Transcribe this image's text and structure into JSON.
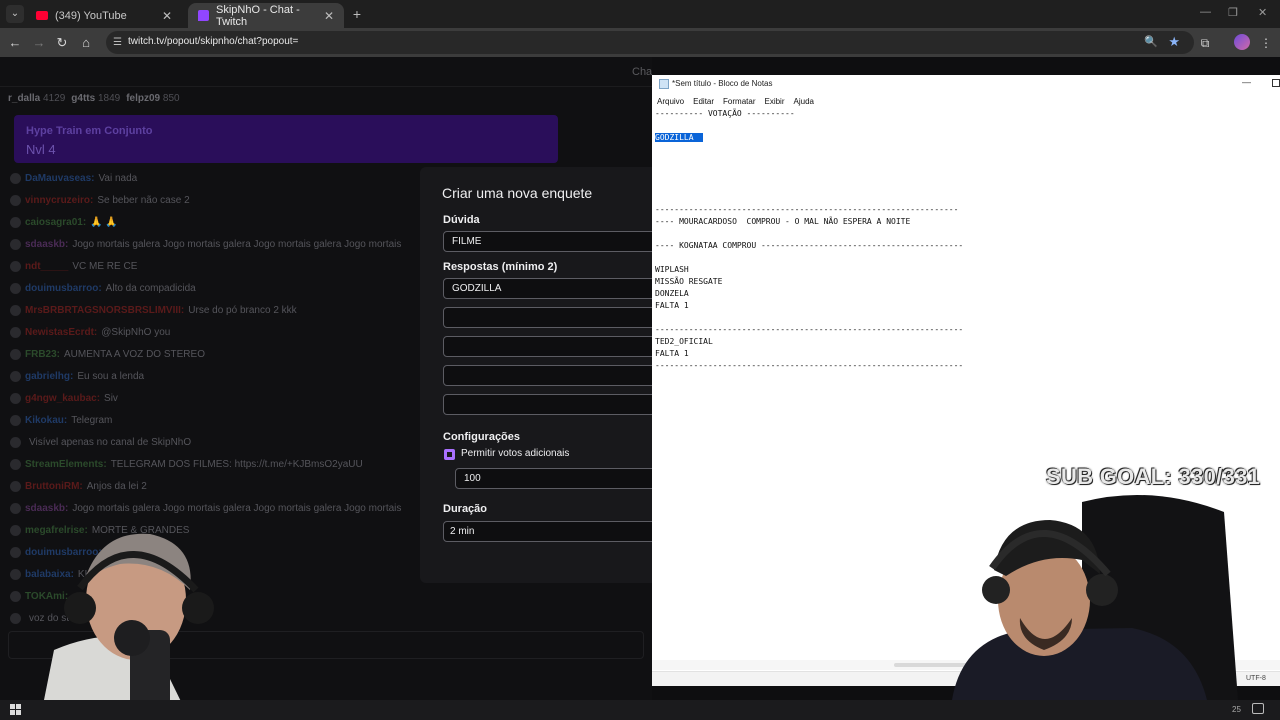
{
  "browser": {
    "tabs": [
      {
        "label": "(349) YouTube"
      },
      {
        "label": "SkipNhO - Chat - Twitch"
      }
    ],
    "url": "twitch.tv/popout/skipnho/chat?popout="
  },
  "chat": {
    "header_title": "Chat Unido",
    "leaderboard": [
      {
        "name": "r_dalla",
        "score": "4129"
      },
      {
        "name": "g4tts",
        "score": "1849"
      },
      {
        "name": "felpz09",
        "score": "850"
      }
    ],
    "hype_train": {
      "title": "Hype Train em Conjunto",
      "level": "Nvl 4"
    },
    "messages": [
      {
        "user": "DaMauvaseas:",
        "text": "Vai nada",
        "color": "#1f3a66"
      },
      {
        "user": "vinnycruzeiro:",
        "text": "Se beber não case 2",
        "color": "#5a1a1a"
      },
      {
        "user": "caiosagra01:",
        "text": "🙏 🙏",
        "color": "#2b4a2b"
      },
      {
        "user": "sdaaskb:",
        "text": "Jogo mortais galera Jogo mortais galera Jogo mortais galera Jogo mortais",
        "color": "#4a2b55"
      },
      {
        "user": "ndt_____",
        "text": "VC ME RE CE",
        "color": "#5a1a1a"
      },
      {
        "user": "douimusbarroo:",
        "text": "Alto da compadicida",
        "color": "#1f3a66"
      },
      {
        "user": "MrsBRBRTAGSNORSBRSLIMVIII:",
        "text": "Urse do pó branco 2 kkk",
        "color": "#5a1a1a"
      },
      {
        "user": "NewistasEcrdt:",
        "text": "@SkipNhO you",
        "color": "#5a1a1a"
      },
      {
        "user": "FRB23:",
        "text": "AUMENTA A VOZ DO STEREO",
        "color": "#2b4a2b"
      },
      {
        "user": "gabrielhg:",
        "text": "Eu sou a lenda",
        "color": "#1f3a66"
      },
      {
        "user": "g4ngw_kaubac:",
        "text": "Siv",
        "color": "#5a1a1a"
      },
      {
        "user": "Kikokau:",
        "text": "Telegram",
        "color": "#1f3a66"
      },
      {
        "user": "",
        "text": "Visível apenas no canal de SkipNhO",
        "color": "#44444a"
      },
      {
        "user": "StreamElements:",
        "text": "TELEGRAM DOS FILMES: https://t.me/+KJBmsO2yaUU",
        "color": "#2b4a2b"
      },
      {
        "user": "BruttoniRM:",
        "text": "Anjos da lei 2",
        "color": "#5a1a1a"
      },
      {
        "user": "sdaaskb:",
        "text": "Jogo mortais galera Jogo mortais galera Jogo mortais galera Jogo mortais",
        "color": "#4a2b55"
      },
      {
        "user": "megafrelrise:",
        "text": "MORTE & GRANDES",
        "color": "#2b4a2b"
      },
      {
        "user": "douimusbarroo:",
        "text": "",
        "color": "#1f3a66"
      },
      {
        "user": "balabaixa:",
        "text": "KKK",
        "color": "#1f3a66"
      },
      {
        "user": "TOKAmi:",
        "text": "",
        "color": "#2b4a2b"
      },
      {
        "user": "",
        "text": "voz do stereo",
        "color": "#5a1a1a"
      }
    ]
  },
  "poll": {
    "title": "Criar uma nova enquete",
    "question_label": "Dúvida",
    "question_value": "FILME",
    "answers_label": "Respostas (mínimo 2)",
    "answers": [
      "GODZILLA",
      "",
      "",
      "",
      ""
    ],
    "settings_label": "Configurações",
    "extra_votes_label": "Permitir votos adicionais",
    "extra_votes_value": "100",
    "duration_label": "Duração",
    "duration_value": "2 min"
  },
  "notepad": {
    "title": "*Sem título - Bloco de Notas",
    "menu": [
      "Arquivo",
      "Editar",
      "Formatar",
      "Exibir",
      "Ajuda"
    ],
    "lines": [
      "---------- VOTAÇÃO ----------",
      "",
      "GODZILLA  ",
      "",
      "",
      "",
      "",
      "",
      "---------------------------------------------------------------",
      "---- MOURACARDOSO  COMPROU - O MAL NÃO ESPERA A NOITE",
      "",
      "---- KOGNATAA COMPROU ------------------------------------------",
      "",
      "WIPLASH",
      "MISSÃO RESGATE",
      "DONZELA",
      "FALTA 1",
      "",
      "----------------------------------------------------------------",
      "TED2_OFICIAL",
      "FALTA 1",
      "----------------------------------------------------------------"
    ],
    "selected_line_index": 2,
    "encoding": "UTF-8"
  },
  "overlay": {
    "sub_goal": "SUB GOAL: 330/331"
  },
  "taskbar": {
    "tray_text": "25"
  }
}
